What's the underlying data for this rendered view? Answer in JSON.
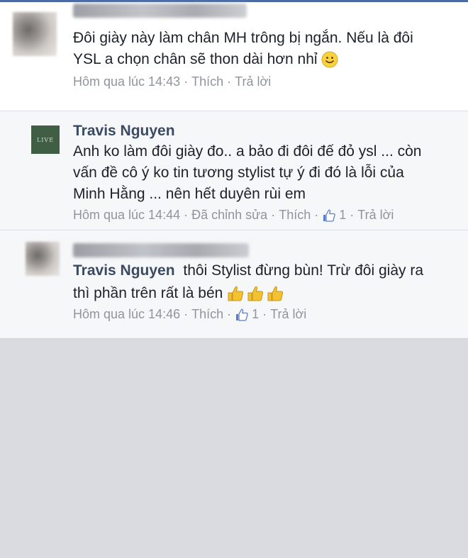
{
  "comments": [
    {
      "text_line1": "Đôi giày này làm chân MH trông bị ngắn. Nếu là đôi",
      "text_line2": "YSL a chọn chân sẽ thon dài hơn nhỉ",
      "time": "Hôm qua lúc 14:43",
      "like_label": "Thích",
      "reply_label": "Trả lời"
    },
    {
      "author": "Travis Nguyen",
      "avatar_text": "LIVE",
      "text_line1": "Anh ko làm đôi giày đo.. a bảo đi đôi đế đỏ ysl ... còn",
      "text_line2": "vấn đề cô ý ko tin tương stylist tự ý đi đó là lỗi của",
      "text_line3": "Minh Hằng ... nên hết duyên rùi em",
      "time": "Hôm qua lúc 14:44",
      "edited_label": "Đã chỉnh sửa",
      "like_label": "Thích",
      "like_count": "1",
      "reply_label": "Trả lời"
    },
    {
      "mention": "Travis Nguyen",
      "text_line1_rest": "thôi Stylist đừng bùn! Trừ đôi giày ra",
      "text_line2": "thì phần trên rất là bén",
      "time": "Hôm qua lúc 14:46",
      "like_label": "Thích",
      "like_count": "1",
      "reply_label": "Trả lời"
    }
  ],
  "icons": {
    "smile": "smile-emoji-icon",
    "thumbs_up": "thumbs-up-emoji-icon",
    "like": "like-icon"
  },
  "colors": {
    "accent": "#4c6ba5",
    "author": "#3b4a63",
    "meta": "#90949c",
    "background": "#d9dbe0"
  }
}
